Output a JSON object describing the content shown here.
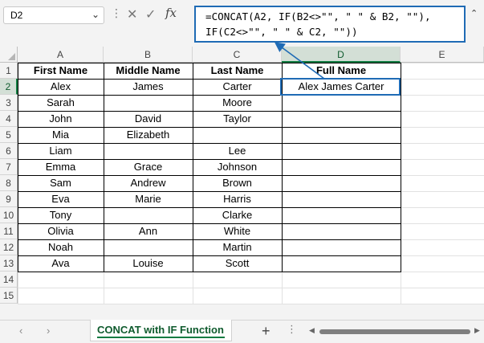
{
  "name_box": {
    "value": "D2",
    "arrow": "⌄"
  },
  "formula_bar": {
    "menu_glyph": "⋮",
    "cancel_glyph": "✕",
    "enter_glyph": "✓",
    "fx_label": "fx",
    "formula_line1": "=CONCAT(A2, IF(B2<>\"\", \" \" & B2, \"\"),",
    "formula_line2": "IF(C2<>\"\", \" \" & C2, \"\"))",
    "expand_glyph": "⌃"
  },
  "columns": [
    "A",
    "B",
    "C",
    "D",
    "E"
  ],
  "active_column": "D",
  "rows": [
    "1",
    "2",
    "3",
    "4",
    "5",
    "6",
    "7",
    "8",
    "9",
    "10",
    "11",
    "12",
    "13",
    "14",
    "15"
  ],
  "active_row": "2",
  "table": {
    "headers": [
      "First Name",
      "Middle Name",
      "Last Name",
      "Full Name"
    ],
    "data": [
      [
        "Alex",
        "James",
        "Carter",
        "Alex James Carter"
      ],
      [
        "Sarah",
        "",
        "Moore",
        ""
      ],
      [
        "John",
        "David",
        "Taylor",
        ""
      ],
      [
        "Mia",
        "Elizabeth",
        "",
        ""
      ],
      [
        "Liam",
        "",
        "Lee",
        ""
      ],
      [
        "Emma",
        "Grace",
        "Johnson",
        ""
      ],
      [
        "Sam",
        "Andrew",
        "Brown",
        ""
      ],
      [
        "Eva",
        "Marie",
        "Harris",
        ""
      ],
      [
        "Tony",
        "",
        "Clarke",
        ""
      ],
      [
        "Olivia",
        "Ann",
        "White",
        ""
      ],
      [
        "Noah",
        "",
        "Martin",
        ""
      ],
      [
        "Ava",
        "Louise",
        "Scott",
        ""
      ]
    ]
  },
  "sheet_bar": {
    "prev_glyph": "‹",
    "next_glyph": "›",
    "tab_label": "CONCAT with IF Function",
    "add_glyph": "+",
    "more_glyph": "⋮",
    "scroll_left_glyph": "◀",
    "scroll_right_glyph": "▶"
  },
  "colors": {
    "accent_blue": "#1f6bb5",
    "excel_green": "#107c41"
  }
}
